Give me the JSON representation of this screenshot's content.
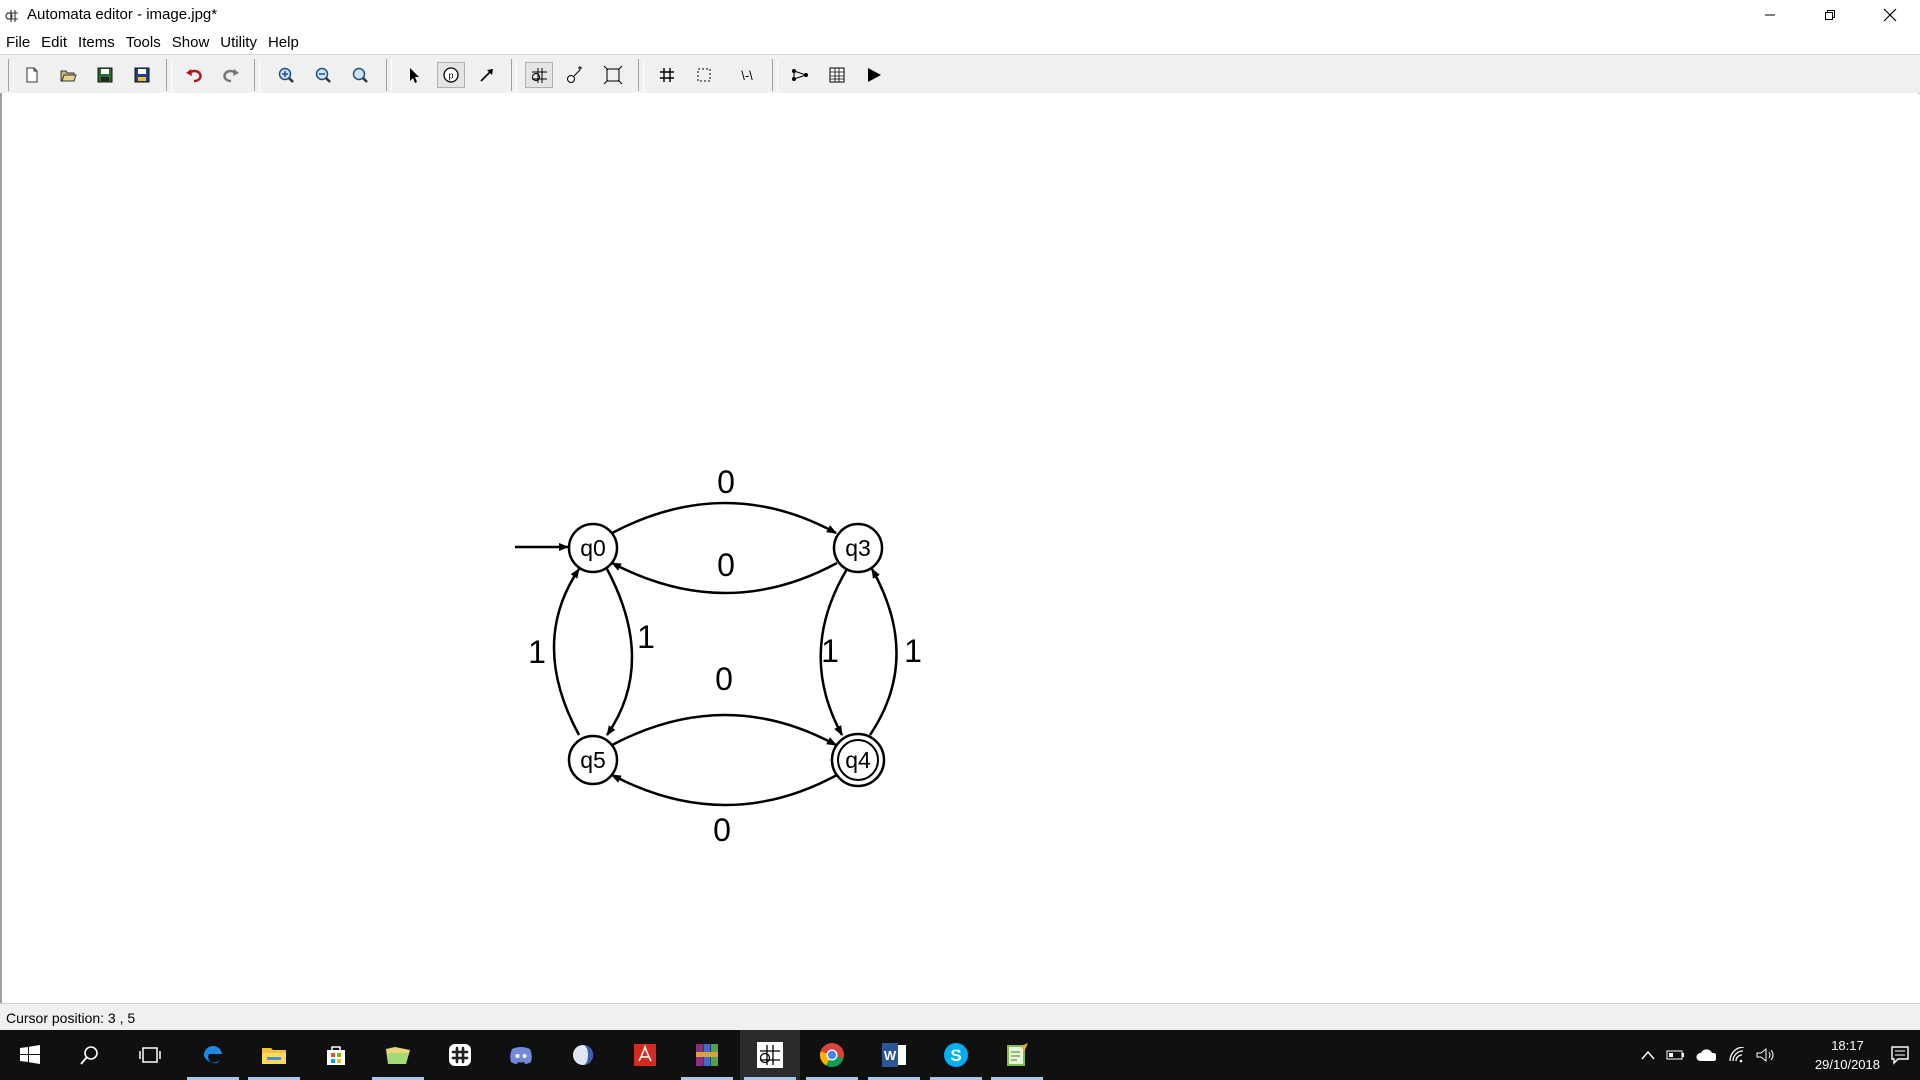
{
  "window": {
    "title": "Automata editor - image.jpg*"
  },
  "menu": [
    "File",
    "Edit",
    "Items",
    "Tools",
    "Show",
    "Utility",
    "Help"
  ],
  "toolbar": {
    "buttons": [
      {
        "icon": "new-file-icon"
      },
      {
        "icon": "open-file-icon"
      },
      {
        "icon": "save-icon"
      },
      {
        "icon": "save-as-icon"
      },
      {
        "icon": "undo-icon"
      },
      {
        "icon": "redo-icon"
      },
      {
        "icon": "zoom-in-icon"
      },
      {
        "icon": "zoom-out-icon"
      },
      {
        "icon": "zoom-fit-icon"
      },
      {
        "icon": "select-pointer-icon"
      },
      {
        "icon": "add-state-icon"
      },
      {
        "icon": "add-transition-icon"
      },
      {
        "icon": "automaton-icon"
      },
      {
        "icon": "state-connect-icon"
      },
      {
        "icon": "layout-icon"
      },
      {
        "icon": "grid-icon"
      },
      {
        "icon": "selection-region-icon"
      },
      {
        "icon": "regex-icon"
      },
      {
        "icon": "graph-tool-icon"
      },
      {
        "icon": "table-icon"
      },
      {
        "icon": "run-icon"
      }
    ]
  },
  "automaton": {
    "states": [
      {
        "id": "q0",
        "label": "q0",
        "initial": true,
        "accepting": false
      },
      {
        "id": "q3",
        "label": "q3",
        "initial": false,
        "accepting": false
      },
      {
        "id": "q5",
        "label": "q5",
        "initial": false,
        "accepting": false
      },
      {
        "id": "q4",
        "label": "q4",
        "initial": false,
        "accepting": true
      }
    ],
    "transitions": [
      {
        "from": "q0",
        "to": "q3",
        "label": "0"
      },
      {
        "from": "q3",
        "to": "q0",
        "label": "0"
      },
      {
        "from": "q0",
        "to": "q5",
        "label": "1"
      },
      {
        "from": "q5",
        "to": "q0",
        "label": "1"
      },
      {
        "from": "q3",
        "to": "q4",
        "label": "1"
      },
      {
        "from": "q4",
        "to": "q3",
        "label": "1"
      },
      {
        "from": "q5",
        "to": "q4",
        "label": "0"
      },
      {
        "from": "q4",
        "to": "q5",
        "label": "0"
      }
    ]
  },
  "status": {
    "text": "Cursor position: 3 , 5"
  },
  "taskbar": {
    "apps": [
      {
        "icon": "start-icon"
      },
      {
        "icon": "search-icon"
      },
      {
        "icon": "task-view-icon"
      },
      {
        "icon": "edge-icon"
      },
      {
        "icon": "file-explorer-icon"
      },
      {
        "icon": "store-icon"
      },
      {
        "icon": "folder-app-icon"
      },
      {
        "icon": "slack-icon"
      },
      {
        "icon": "discord-icon"
      },
      {
        "icon": "app-icon"
      },
      {
        "icon": "acrobat-icon"
      },
      {
        "icon": "winrar-icon"
      },
      {
        "icon": "automata-editor-icon"
      },
      {
        "icon": "chrome-icon"
      },
      {
        "icon": "word-icon"
      },
      {
        "icon": "skype-icon"
      },
      {
        "icon": "notepad-icon"
      }
    ],
    "time": "18:17",
    "date": "29/10/2018"
  },
  "colors": {
    "taskbar_bg": "#101010",
    "toolbar_bg": "#f0f0f0",
    "active_indicator": "#a6c8ea"
  }
}
